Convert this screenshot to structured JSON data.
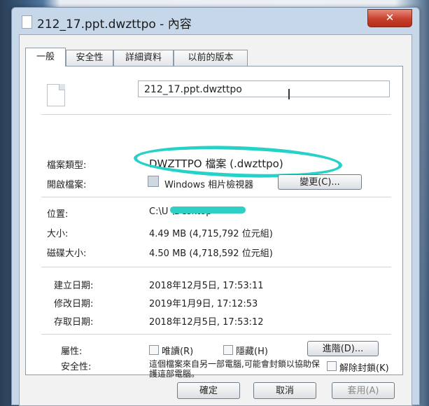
{
  "window": {
    "title": "212_17.ppt.dwzttpo - 內容",
    "close_glyph": "✕"
  },
  "tabs": [
    {
      "label": "一般"
    },
    {
      "label": "安全性"
    },
    {
      "label": "詳細資料"
    },
    {
      "label": "以前的版本"
    }
  ],
  "general": {
    "file_name": "212_17.ppt.dwzttpo",
    "type_label": "檔案類型:",
    "type_value": "DWZTTPO 檔案 (.dwzttpo)",
    "opens_with_label": "開啟檔案:",
    "opens_with_value": "Windows 相片檢視器",
    "change_button": "變更(C)...",
    "location_label": "位置:",
    "location_value": "C:\\U        \\Desktop",
    "size_label": "大小:",
    "size_value": "4.49 MB (4,715,792 位元組)",
    "size_on_disk_label": "磁碟大小:",
    "size_on_disk_value": "4.50 MB (4,718,592 位元組)",
    "created_label": "建立日期:",
    "created_value": "2018年12月5日, 17:53:11",
    "modified_label": "修改日期:",
    "modified_value": "2019年1月9日, 17:12:53",
    "accessed_label": "存取日期:",
    "accessed_value": "2018年12月5日, 17:53:12",
    "attributes_label": "屬性:",
    "readonly_label": "唯讀(R)",
    "hidden_label": "隱藏(H)",
    "advanced_button": "進階(D)...",
    "security_label": "安全性:",
    "security_text": "這個檔案來自另一部電腦,可能會封鎖以協助保護這部電腦。",
    "unblock_button": "解除封鎖(K)"
  },
  "footer": {
    "ok": "確定",
    "cancel": "取消",
    "apply": "套用(A)"
  },
  "colors": {
    "highlight_circle": "#26d1c8",
    "close_button": "#c7402c"
  }
}
